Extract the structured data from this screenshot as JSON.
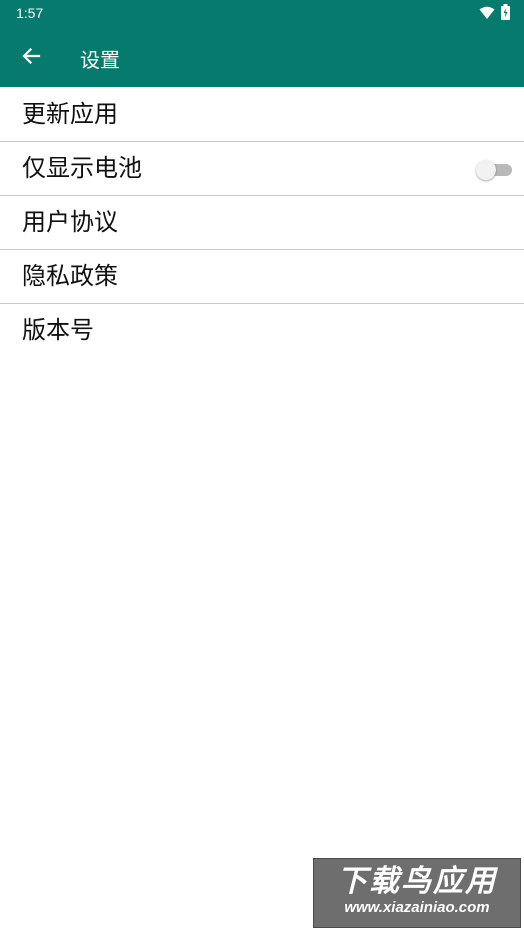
{
  "status_bar": {
    "time": "1:57",
    "icons": [
      "wifi-icon",
      "battery-icon"
    ]
  },
  "app_bar": {
    "title": "设置",
    "back_icon": "arrow-left-icon",
    "background": "#067a6c"
  },
  "settings": {
    "items": [
      {
        "label": "更新应用"
      },
      {
        "label": "仅显示电池",
        "toggle": "off"
      },
      {
        "label": "用户协议"
      },
      {
        "label": "隐私政策"
      },
      {
        "label": "版本号"
      }
    ]
  },
  "watermark": {
    "line1": "下载鸟应用",
    "line2": "www.xiazainiao.com"
  }
}
